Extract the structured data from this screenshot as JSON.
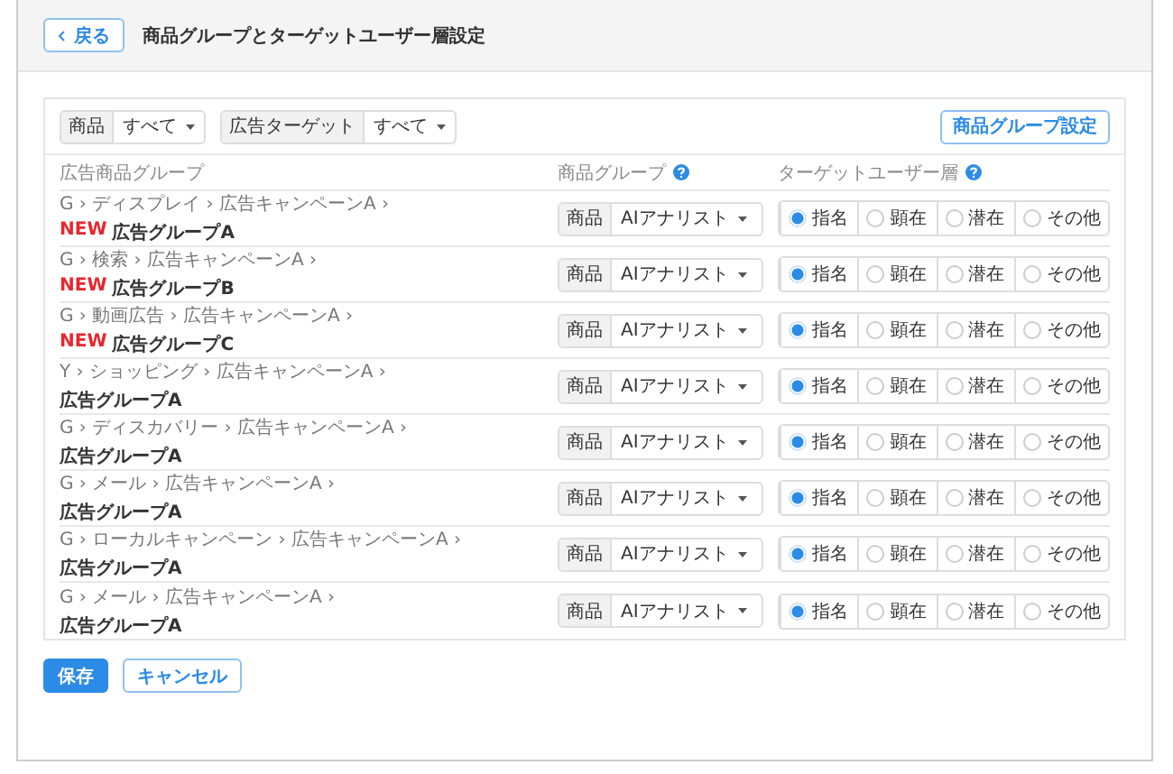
{
  "header": {
    "back_label": "戻る",
    "title": "商品グループとターゲットユーザー層設定"
  },
  "filters": [
    {
      "label": "商品",
      "value": "すべて"
    },
    {
      "label": "広告ターゲット",
      "value": "すべて"
    }
  ],
  "settings_button": "商品グループ設定",
  "columns": [
    {
      "label": "広告商品グループ",
      "help": false
    },
    {
      "label": "商品グループ",
      "help": true
    },
    {
      "label": "ターゲットユーザー層",
      "help": true
    }
  ],
  "rows": [
    {
      "path": "G › ディスプレイ › 広告キャンペーンA ›",
      "badge": "NEW",
      "name": "広告グループA",
      "product": {
        "label": "商品",
        "value": "AIアナリスト"
      },
      "targets": [
        {
          "label": "指名",
          "selected": true
        },
        {
          "label": "顕在",
          "selected": false
        },
        {
          "label": "潜在",
          "selected": false
        },
        {
          "label": "その他",
          "selected": false
        }
      ]
    },
    {
      "path": "G › 検索 › 広告キャンペーンA ›",
      "badge": "NEW",
      "name": "広告グループB",
      "product": {
        "label": "商品",
        "value": "AIアナリスト"
      },
      "targets": [
        {
          "label": "指名",
          "selected": true
        },
        {
          "label": "顕在",
          "selected": false
        },
        {
          "label": "潜在",
          "selected": false
        },
        {
          "label": "その他",
          "selected": false
        }
      ]
    },
    {
      "path": "G › 動画広告 › 広告キャンペーンA ›",
      "badge": "NEW",
      "name": "広告グループC",
      "product": {
        "label": "商品",
        "value": "AIアナリスト"
      },
      "targets": [
        {
          "label": "指名",
          "selected": true
        },
        {
          "label": "顕在",
          "selected": false
        },
        {
          "label": "潜在",
          "selected": false
        },
        {
          "label": "その他",
          "selected": false
        }
      ]
    },
    {
      "path": "Y › ショッピング › 広告キャンペーンA ›",
      "name": "広告グループA",
      "product": {
        "label": "商品",
        "value": "AIアナリスト"
      },
      "targets": [
        {
          "label": "指名",
          "selected": true
        },
        {
          "label": "顕在",
          "selected": false
        },
        {
          "label": "潜在",
          "selected": false
        },
        {
          "label": "その他",
          "selected": false
        }
      ]
    },
    {
      "path": "G › ディスカバリー › 広告キャンペーンA ›",
      "name": "広告グループA",
      "product": {
        "label": "商品",
        "value": "AIアナリスト"
      },
      "targets": [
        {
          "label": "指名",
          "selected": true
        },
        {
          "label": "顕在",
          "selected": false
        },
        {
          "label": "潜在",
          "selected": false
        },
        {
          "label": "その他",
          "selected": false
        }
      ]
    },
    {
      "path": "G › メール › 広告キャンペーンA ›",
      "name": "広告グループA",
      "product": {
        "label": "商品",
        "value": "AIアナリスト"
      },
      "targets": [
        {
          "label": "指名",
          "selected": true
        },
        {
          "label": "顕在",
          "selected": false
        },
        {
          "label": "潜在",
          "selected": false
        },
        {
          "label": "その他",
          "selected": false
        }
      ]
    },
    {
      "path": "G › ローカルキャンペーン › 広告キャンペーンA ›",
      "name": "広告グループA",
      "product": {
        "label": "商品",
        "value": "AIアナリスト"
      },
      "targets": [
        {
          "label": "指名",
          "selected": true
        },
        {
          "label": "顕在",
          "selected": false
        },
        {
          "label": "潜在",
          "selected": false
        },
        {
          "label": "その他",
          "selected": false
        }
      ]
    },
    {
      "path": "G › メール › 広告キャンペーンA ›",
      "name": "広告グループA",
      "product": {
        "label": "商品",
        "value": "AIアナリスト"
      },
      "targets": [
        {
          "label": "指名",
          "selected": true
        },
        {
          "label": "顕在",
          "selected": false
        },
        {
          "label": "潜在",
          "selected": false
        },
        {
          "label": "その他",
          "selected": false
        }
      ]
    }
  ],
  "actions": [
    {
      "label": "保存",
      "kind": "primary"
    },
    {
      "label": "キャンセル",
      "kind": "secondary"
    }
  ]
}
